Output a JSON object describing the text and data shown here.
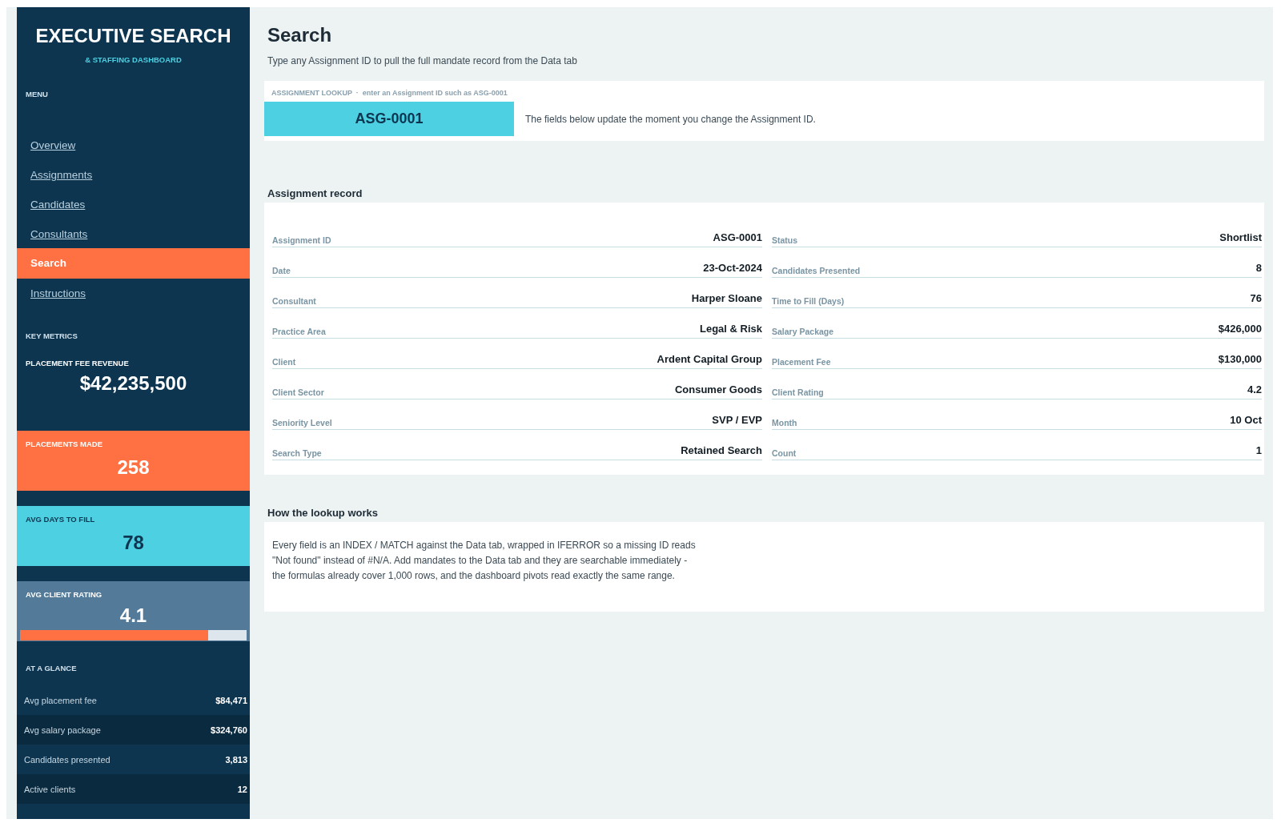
{
  "sidebar": {
    "title": "EXECUTIVE SEARCH",
    "subtitle": "& STAFFING DASHBOARD",
    "menu_label": "MENU",
    "menu": [
      {
        "label": "Overview",
        "selected": false
      },
      {
        "label": "Assignments",
        "selected": false
      },
      {
        "label": "Candidates",
        "selected": false
      },
      {
        "label": "Consultants",
        "selected": false
      },
      {
        "label": "Search",
        "selected": true
      },
      {
        "label": "Instructions",
        "selected": false
      }
    ],
    "key_metrics_label": "KEY METRICS",
    "metrics": [
      {
        "kind": "plain",
        "label": "PLACEMENT FEE REVENUE",
        "value": "$42,235,500"
      },
      {
        "kind": "tile",
        "label": "PLACEMENTS MADE",
        "value": "258",
        "color": "#ff7043"
      },
      {
        "kind": "tile",
        "label": "AVG DAYS TO FILL",
        "value": "78",
        "color": "#4dd0e1"
      },
      {
        "kind": "rating",
        "label": "AVG CLIENT RATING",
        "value": "4.1",
        "color": "#537b99",
        "level": 0.83
      }
    ],
    "glance_label": "AT A GLANCE",
    "glance": [
      {
        "label": "Avg placement fee",
        "value": "$84,471"
      },
      {
        "label": "Avg salary package",
        "value": "$324,760"
      },
      {
        "label": "Candidates presented",
        "value": "3,813"
      },
      {
        "label": "Active clients",
        "value": "12"
      }
    ]
  },
  "main": {
    "title": "Search",
    "subtitle": "Type any Assignment ID to pull the full mandate record from the Data tab",
    "lookup": {
      "label": "ASSIGNMENT LOOKUP",
      "separator": "·",
      "hint": "enter an Assignment ID such as ASG-0001",
      "value": "ASG-0001",
      "note": "The fields below update the moment you change the Assignment ID."
    },
    "record": {
      "heading": "Assignment record",
      "fields": [
        {
          "label": "Assignment ID",
          "value": "ASG-0001"
        },
        {
          "label": "Status",
          "value": "Shortlist"
        },
        {
          "label": "Date",
          "value": "23-Oct-2024"
        },
        {
          "label": "Candidates Presented",
          "value": "8"
        },
        {
          "label": "Consultant",
          "value": "Harper Sloane"
        },
        {
          "label": "Time to Fill (Days)",
          "value": "76"
        },
        {
          "label": "Practice Area",
          "value": "Legal & Risk"
        },
        {
          "label": "Salary Package",
          "value": "$426,000"
        },
        {
          "label": "Client",
          "value": "Ardent Capital Group"
        },
        {
          "label": "Placement Fee",
          "value": "$130,000"
        },
        {
          "label": "Client Sector",
          "value": "Consumer Goods"
        },
        {
          "label": "Client Rating",
          "value": "4.2"
        },
        {
          "label": "Seniority Level",
          "value": "SVP / EVP"
        },
        {
          "label": "Month",
          "value": "10 Oct"
        },
        {
          "label": "Search Type",
          "value": "Retained Search"
        },
        {
          "label": "Count",
          "value": "1"
        }
      ]
    },
    "how": {
      "heading": "How the lookup works",
      "text": "Every field is an INDEX / MATCH against the Data tab, wrapped in IFERROR so a missing ID reads \"Not found\" instead of #N/A. Add mandates to the Data tab and they are searchable immediately - the formulas already cover 1,000 rows, and the dashboard pivots read exactly the same range."
    }
  }
}
